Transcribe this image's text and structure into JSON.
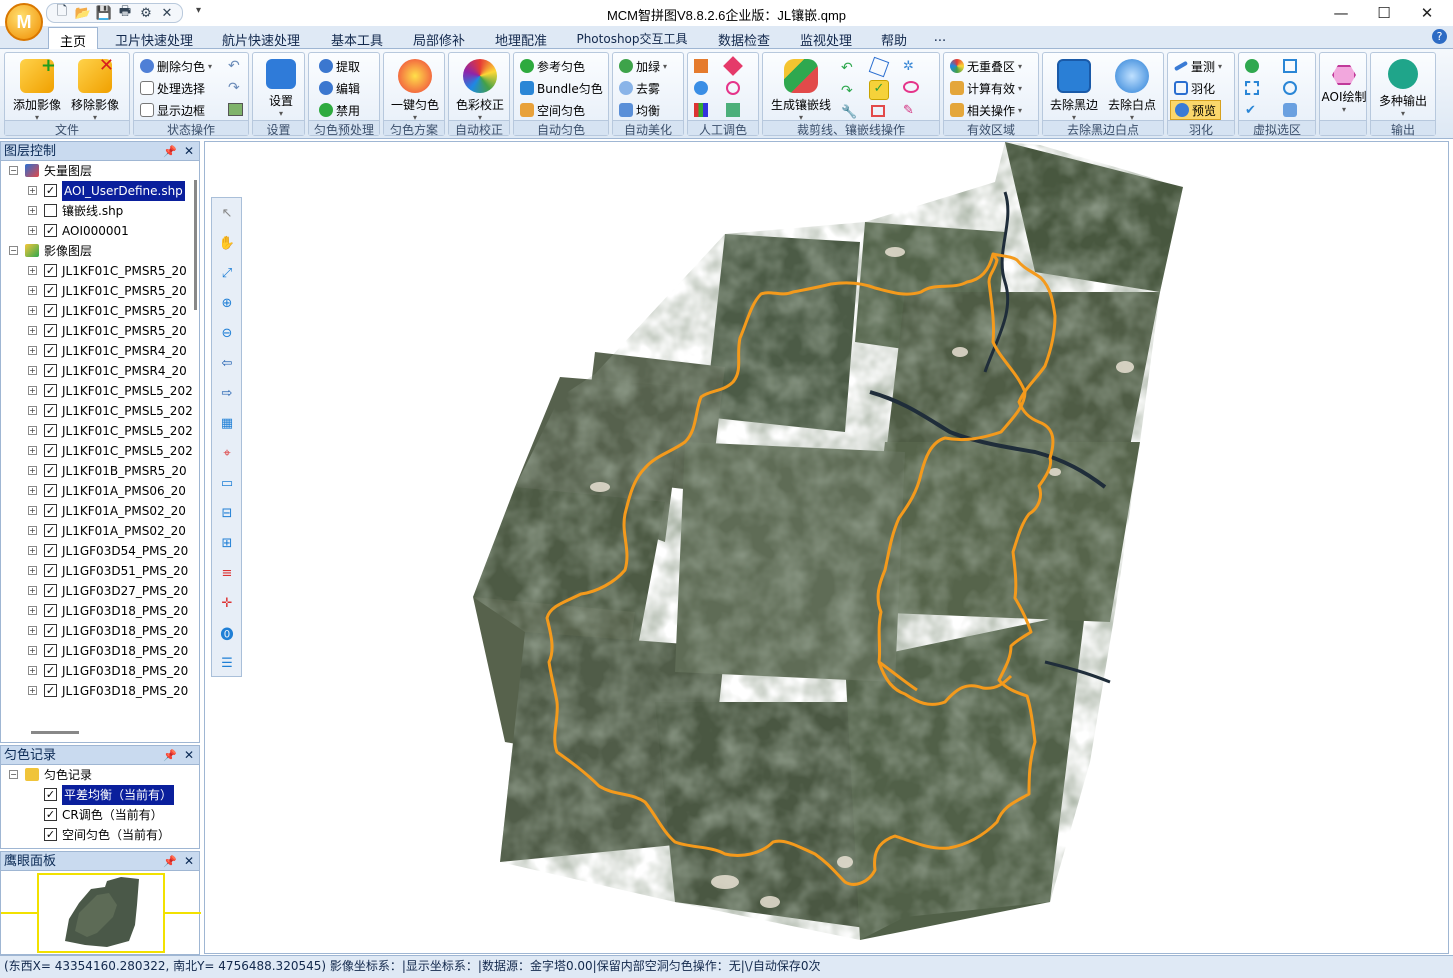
{
  "app": {
    "title": "MCM智拼图V8.8.2.6企业版：JL镶嵌.qmp",
    "logo_letter": "M"
  },
  "quick_access": {
    "icons": [
      "new-file-icon",
      "open-folder-icon",
      "save-icon",
      "print-icon",
      "settings-icon",
      "close-icon"
    ],
    "more_label": "▾"
  },
  "window_controls": {
    "minimize": "—",
    "maximize": "☐",
    "close": "✕"
  },
  "tabs": [
    "主页",
    "卫片快速处理",
    "航片快速处理",
    "基本工具",
    "局部修补",
    "地理配准",
    "Photoshop交互工具",
    "数据检查",
    "监视处理",
    "帮助",
    "..."
  ],
  "ribbon": {
    "file": {
      "label": "文件",
      "add_image": "添加影像",
      "remove_image": "移除影像"
    },
    "status": {
      "label": "状态操作",
      "delete_balance": "删除匀色",
      "process_select": "处理选择",
      "show_border": "显示边框"
    },
    "settings": {
      "label": "设置",
      "button": "设置"
    },
    "preprocess": {
      "label": "匀色预处理",
      "extract": "提取",
      "edit": "编辑",
      "disable": "禁用"
    },
    "scheme": {
      "label": "匀色方案",
      "button": "一键匀色"
    },
    "auto_correct": {
      "label": "自动校正",
      "button": "色彩校正"
    },
    "auto_balance": {
      "label": "自动匀色",
      "ref": "参考匀色",
      "bundle": "Bundle匀色",
      "spatial": "空间匀色"
    },
    "beautify": {
      "label": "自动美化",
      "thicken": "加绿",
      "defog": "去雾",
      "equalize": "均衡"
    },
    "manual": {
      "label": "人工调色"
    },
    "cutline": {
      "label": "裁剪线、镶嵌线操作",
      "button": "生成镶嵌线"
    },
    "valid": {
      "label": "有效区域",
      "no_overlap": "无重叠区",
      "calc_valid": "计算有效",
      "related": "相关操作"
    },
    "black_edge": {
      "label": "去除黑边白点",
      "remove_black": "去除黑边",
      "remove_white": "去除白点"
    },
    "feather": {
      "label": "羽化",
      "measure": "量测",
      "feather": "羽化",
      "preview": "预览"
    },
    "virtual": {
      "label": "虚拟选区"
    },
    "aoi": {
      "label": "",
      "button": "AOI绘制"
    },
    "output": {
      "label": "输出",
      "button": "多种输出"
    }
  },
  "layer_panel": {
    "title": "图层控制",
    "vector_group": "矢量图层",
    "vectors": [
      {
        "name": "AOI_UserDefine.shp",
        "checked": true,
        "selected": true
      },
      {
        "name": "镶嵌线.shp",
        "checked": false,
        "selected": false
      },
      {
        "name": "AOI000001",
        "checked": true,
        "selected": false
      }
    ],
    "image_group": "影像图层",
    "images": [
      "JL1KF01C_PMSR5_20",
      "JL1KF01C_PMSR5_20",
      "JL1KF01C_PMSR5_20",
      "JL1KF01C_PMSR5_20",
      "JL1KF01C_PMSR4_20",
      "JL1KF01C_PMSR4_20",
      "JL1KF01C_PMSL5_202",
      "JL1KF01C_PMSL5_202",
      "JL1KF01C_PMSL5_202",
      "JL1KF01C_PMSL5_202",
      "JL1KF01B_PMSR5_20",
      "JL1KF01A_PMS06_20",
      "JL1KF01A_PMS02_20",
      "JL1KF01A_PMS02_20",
      "JL1GF03D54_PMS_20",
      "JL1GF03D51_PMS_20",
      "JL1GF03D27_PMS_20",
      "JL1GF03D18_PMS_20",
      "JL1GF03D18_PMS_20",
      "JL1GF03D18_PMS_20",
      "JL1GF03D18_PMS_20",
      "JL1GF03D18_PMS_20"
    ]
  },
  "balance_panel": {
    "title": "匀色记录",
    "root": "匀色记录",
    "items": [
      {
        "name": "平差均衡（当前有）",
        "selected": true
      },
      {
        "name": "CR调色（当前有）",
        "selected": false
      },
      {
        "name": "空间匀色（当前有）",
        "selected": false
      }
    ]
  },
  "eagle_panel": {
    "title": "鹰眼面板"
  },
  "status": {
    "text": "(东西X= 43354160.280322, 南北Y= 4756488.320545) 影像坐标系：|显示坐标系：|数据源：金字塔0.00|保留内部空洞匀色操作：无|\\/自动保存0次"
  },
  "colors": {
    "aoi_line": "#f49a1c",
    "selection": "#0a1f9c",
    "ribbon_blue": "#dfe9f5"
  }
}
